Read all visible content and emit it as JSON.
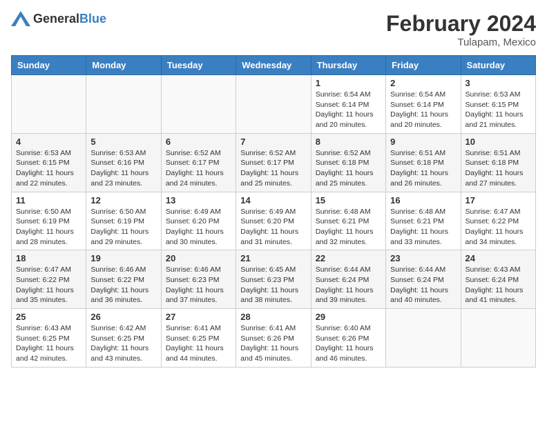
{
  "header": {
    "logo_general": "General",
    "logo_blue": "Blue",
    "month_year": "February 2024",
    "location": "Tulapam, Mexico"
  },
  "days_of_week": [
    "Sunday",
    "Monday",
    "Tuesday",
    "Wednesday",
    "Thursday",
    "Friday",
    "Saturday"
  ],
  "weeks": [
    [
      {
        "day": "",
        "info": ""
      },
      {
        "day": "",
        "info": ""
      },
      {
        "day": "",
        "info": ""
      },
      {
        "day": "",
        "info": ""
      },
      {
        "day": "1",
        "info": "Sunrise: 6:54 AM\nSunset: 6:14 PM\nDaylight: 11 hours and 20 minutes."
      },
      {
        "day": "2",
        "info": "Sunrise: 6:54 AM\nSunset: 6:14 PM\nDaylight: 11 hours and 20 minutes."
      },
      {
        "day": "3",
        "info": "Sunrise: 6:53 AM\nSunset: 6:15 PM\nDaylight: 11 hours and 21 minutes."
      }
    ],
    [
      {
        "day": "4",
        "info": "Sunrise: 6:53 AM\nSunset: 6:15 PM\nDaylight: 11 hours and 22 minutes."
      },
      {
        "day": "5",
        "info": "Sunrise: 6:53 AM\nSunset: 6:16 PM\nDaylight: 11 hours and 23 minutes."
      },
      {
        "day": "6",
        "info": "Sunrise: 6:52 AM\nSunset: 6:17 PM\nDaylight: 11 hours and 24 minutes."
      },
      {
        "day": "7",
        "info": "Sunrise: 6:52 AM\nSunset: 6:17 PM\nDaylight: 11 hours and 25 minutes."
      },
      {
        "day": "8",
        "info": "Sunrise: 6:52 AM\nSunset: 6:18 PM\nDaylight: 11 hours and 25 minutes."
      },
      {
        "day": "9",
        "info": "Sunrise: 6:51 AM\nSunset: 6:18 PM\nDaylight: 11 hours and 26 minutes."
      },
      {
        "day": "10",
        "info": "Sunrise: 6:51 AM\nSunset: 6:18 PM\nDaylight: 11 hours and 27 minutes."
      }
    ],
    [
      {
        "day": "11",
        "info": "Sunrise: 6:50 AM\nSunset: 6:19 PM\nDaylight: 11 hours and 28 minutes."
      },
      {
        "day": "12",
        "info": "Sunrise: 6:50 AM\nSunset: 6:19 PM\nDaylight: 11 hours and 29 minutes."
      },
      {
        "day": "13",
        "info": "Sunrise: 6:49 AM\nSunset: 6:20 PM\nDaylight: 11 hours and 30 minutes."
      },
      {
        "day": "14",
        "info": "Sunrise: 6:49 AM\nSunset: 6:20 PM\nDaylight: 11 hours and 31 minutes."
      },
      {
        "day": "15",
        "info": "Sunrise: 6:48 AM\nSunset: 6:21 PM\nDaylight: 11 hours and 32 minutes."
      },
      {
        "day": "16",
        "info": "Sunrise: 6:48 AM\nSunset: 6:21 PM\nDaylight: 11 hours and 33 minutes."
      },
      {
        "day": "17",
        "info": "Sunrise: 6:47 AM\nSunset: 6:22 PM\nDaylight: 11 hours and 34 minutes."
      }
    ],
    [
      {
        "day": "18",
        "info": "Sunrise: 6:47 AM\nSunset: 6:22 PM\nDaylight: 11 hours and 35 minutes."
      },
      {
        "day": "19",
        "info": "Sunrise: 6:46 AM\nSunset: 6:22 PM\nDaylight: 11 hours and 36 minutes."
      },
      {
        "day": "20",
        "info": "Sunrise: 6:46 AM\nSunset: 6:23 PM\nDaylight: 11 hours and 37 minutes."
      },
      {
        "day": "21",
        "info": "Sunrise: 6:45 AM\nSunset: 6:23 PM\nDaylight: 11 hours and 38 minutes."
      },
      {
        "day": "22",
        "info": "Sunrise: 6:44 AM\nSunset: 6:24 PM\nDaylight: 11 hours and 39 minutes."
      },
      {
        "day": "23",
        "info": "Sunrise: 6:44 AM\nSunset: 6:24 PM\nDaylight: 11 hours and 40 minutes."
      },
      {
        "day": "24",
        "info": "Sunrise: 6:43 AM\nSunset: 6:24 PM\nDaylight: 11 hours and 41 minutes."
      }
    ],
    [
      {
        "day": "25",
        "info": "Sunrise: 6:43 AM\nSunset: 6:25 PM\nDaylight: 11 hours and 42 minutes."
      },
      {
        "day": "26",
        "info": "Sunrise: 6:42 AM\nSunset: 6:25 PM\nDaylight: 11 hours and 43 minutes."
      },
      {
        "day": "27",
        "info": "Sunrise: 6:41 AM\nSunset: 6:25 PM\nDaylight: 11 hours and 44 minutes."
      },
      {
        "day": "28",
        "info": "Sunrise: 6:41 AM\nSunset: 6:26 PM\nDaylight: 11 hours and 45 minutes."
      },
      {
        "day": "29",
        "info": "Sunrise: 6:40 AM\nSunset: 6:26 PM\nDaylight: 11 hours and 46 minutes."
      },
      {
        "day": "",
        "info": ""
      },
      {
        "day": "",
        "info": ""
      }
    ]
  ]
}
